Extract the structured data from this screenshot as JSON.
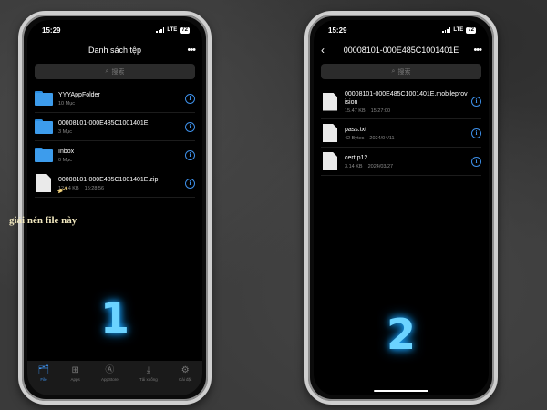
{
  "left_phone": {
    "status": {
      "time": "15:29",
      "network": "LTE",
      "battery": "72"
    },
    "nav": {
      "title": "Danh sách tệp",
      "more": "•••"
    },
    "search": {
      "placeholder": "搜索"
    },
    "items": [
      {
        "type": "folder",
        "name": "YYYAppFolder",
        "meta": "10 Mục",
        "time": ""
      },
      {
        "type": "folder",
        "name": "00008101-000E485C1001401E",
        "meta": "3 Mục",
        "time": ""
      },
      {
        "type": "folder",
        "name": "Inbox",
        "meta": "0 Mục",
        "time": ""
      },
      {
        "type": "file",
        "name": "00008101-000E485C1001401E.zip",
        "meta": "12.14 KB",
        "time": "15:28:56"
      }
    ],
    "annotation": "giải nén file này",
    "step_number": "1",
    "tabs": [
      {
        "label": "File",
        "icon": "folder-tab-icon",
        "glyph": "🗂",
        "active": true
      },
      {
        "label": "Apps",
        "icon": "apps-grid-icon",
        "glyph": "⊞",
        "active": false
      },
      {
        "label": "AppStore",
        "icon": "appstore-icon",
        "glyph": "Ⓐ",
        "active": false
      },
      {
        "label": "Tải xuống",
        "icon": "download-icon",
        "glyph": "⤓",
        "active": false
      },
      {
        "label": "Cài đặt",
        "icon": "settings-gear-icon",
        "glyph": "⚙",
        "active": false
      }
    ]
  },
  "right_phone": {
    "status": {
      "time": "15:29",
      "network": "LTE",
      "battery": "72"
    },
    "nav": {
      "back": "‹",
      "title": "00008101-000E485C1001401E",
      "more": "•••"
    },
    "search": {
      "placeholder": "搜索"
    },
    "items": [
      {
        "type": "file",
        "name": "00008101-000E485C1001401E.mobileprovision",
        "meta": "15.47 KB",
        "time": "15:27:00"
      },
      {
        "type": "file",
        "name": "pass.txt",
        "meta": "42 Bytes",
        "time": "2024/04/11"
      },
      {
        "type": "file",
        "name": "cert.p12",
        "meta": "3.14 KB",
        "time": "2024/03/27"
      }
    ],
    "step_number": "2"
  },
  "colors": {
    "accent": "#3d8fe8",
    "folder": "#3d9cec",
    "glow": "#6bd3ff",
    "annotation": "#f2e9c0"
  }
}
